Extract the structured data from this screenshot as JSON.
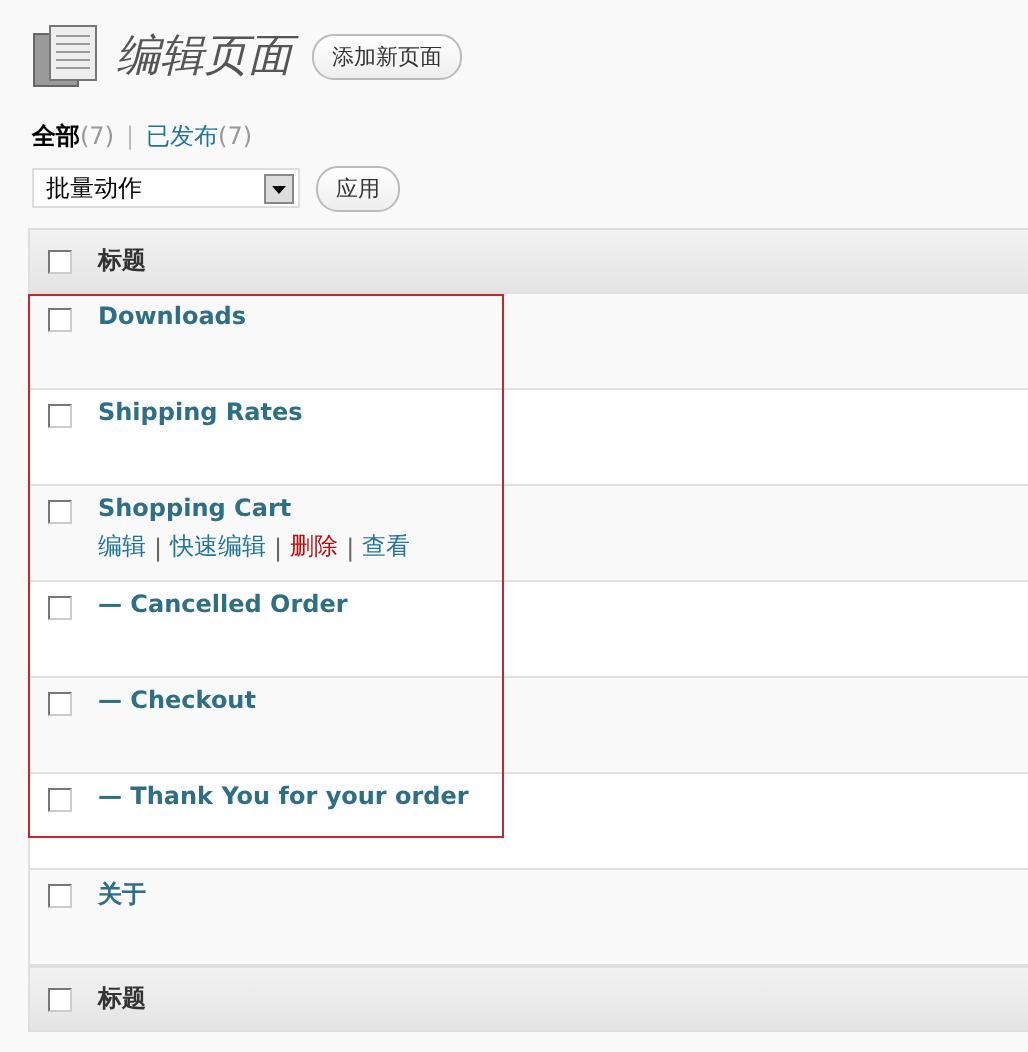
{
  "page_title": "编辑页面",
  "add_button": "添加新页面",
  "filters": [
    {
      "label": "全部",
      "count": "(7)",
      "selected": true
    },
    {
      "separator_before": "|",
      "label": "已发布",
      "count": "(7)",
      "selected": false
    }
  ],
  "bulk_actions": {
    "value": "批量动作",
    "apply": "应用"
  },
  "table": {
    "header": {
      "title": "标题",
      "checked": false
    },
    "annotated_rows": {
      "kind": "red-box",
      "rows": [
        {
          "title": "Downloads",
          "checked": false
        },
        {
          "title": "Shipping Rates",
          "checked": false
        },
        {
          "title": "Shopping Cart",
          "checked": false,
          "actions": [
            {
              "label": "编辑",
              "kind": "link"
            },
            {
              "separator_before": "|",
              "label": "快速编辑",
              "kind": "link"
            },
            {
              "separator_before": "|",
              "label": "删除",
              "kind": "delete"
            },
            {
              "separator_before": "|",
              "label": "查看",
              "kind": "link"
            }
          ]
        },
        {
          "title": "— Cancelled Order",
          "checked": false
        },
        {
          "title": "— Checkout",
          "checked": false
        },
        {
          "title": "— Thank You for your order",
          "checked": false
        }
      ]
    },
    "rows": [
      {
        "title": "关于",
        "checked": false
      }
    ],
    "footer": {
      "title": "标题",
      "checked": false
    }
  }
}
